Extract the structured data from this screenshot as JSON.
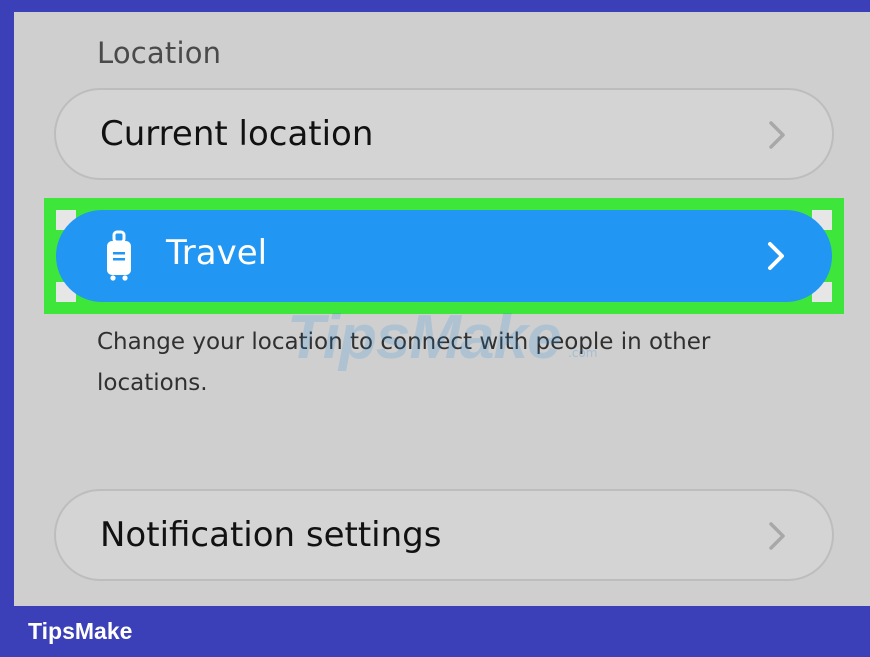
{
  "location_section": {
    "label": "Location"
  },
  "current_location": {
    "label": "Current location",
    "icon": "chevron-right-icon"
  },
  "travel": {
    "label": "Travel",
    "icon": "luggage-icon",
    "chevron_icon": "chevron-right-icon",
    "description": "Change your location to connect with people in other locations.",
    "colors": {
      "button": "#2196f3",
      "highlight": "#3ee53a"
    }
  },
  "notification_settings": {
    "label": "Notification settings",
    "icon": "chevron-right-icon"
  },
  "watermark": {
    "text": "TipsMake",
    "suffix": ".com"
  },
  "footer": {
    "brand": "TipsMake",
    "color": "#3b40b8"
  }
}
